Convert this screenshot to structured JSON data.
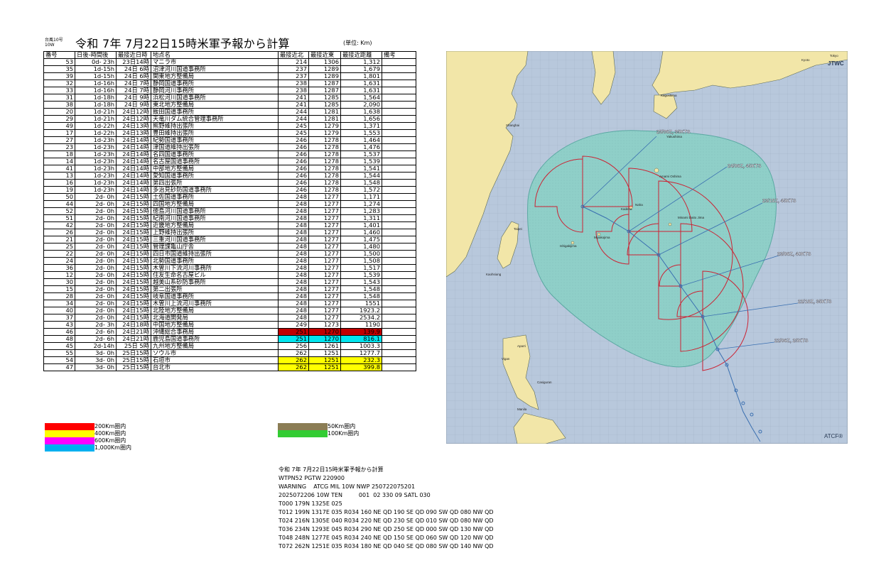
{
  "header": {
    "small_line1": "台風10号",
    "small_line2": "10W",
    "title": "令和 7年 7月22日15時米軍予報から計算",
    "unit": "(単位: Km)"
  },
  "table": {
    "columns": [
      "番号",
      "日後-時間後",
      "最接近日時",
      "地点名",
      "最接近北",
      "最接近東",
      "最接近距離",
      "備考"
    ],
    "rows": [
      [
        "53",
        "0d- 23h",
        "23日14時",
        "マニラ市",
        "214",
        "1306",
        "1,312",
        "",
        ""
      ],
      [
        "35",
        "1d-15h",
        "24日 6時",
        "沼津河川国道事務所",
        "237",
        "1289",
        "1,679",
        "",
        ""
      ],
      [
        "39",
        "1d-15h",
        "24日 6時",
        "関東地方整備局",
        "237",
        "1289",
        "1,801",
        "",
        ""
      ],
      [
        "32",
        "1d-16h",
        "24日 7時",
        "静岡国道事務所",
        "238",
        "1287",
        "1,631",
        "",
        ""
      ],
      [
        "33",
        "1d-16h",
        "24日 7時",
        "静岡河川事務所",
        "238",
        "1287",
        "1,631",
        "",
        ""
      ],
      [
        "31",
        "1d-18h",
        "24日 9時",
        "浜松河川国道事務所",
        "241",
        "1285",
        "1,564",
        "",
        ""
      ],
      [
        "38",
        "1d-18h",
        "24日 9時",
        "東北地方整備局",
        "241",
        "1285",
        "2,090",
        "",
        ""
      ],
      [
        "20",
        "1d-21h",
        "24日12時",
        "飯田国道事務所",
        "244",
        "1281",
        "1,638",
        "",
        ""
      ],
      [
        "29",
        "1d-21h",
        "24日12時",
        "天竜川ダム統合管理事務所",
        "244",
        "1281",
        "1,656",
        "",
        ""
      ],
      [
        "49",
        "1d-22h",
        "24日13時",
        "熊野維持出張所",
        "245",
        "1279",
        "1,371",
        "",
        ""
      ],
      [
        "17",
        "1d-22h",
        "24日13時",
        "豊田維持出張所",
        "245",
        "1279",
        "1,553",
        "",
        ""
      ],
      [
        "27",
        "1d-23h",
        "24日14時",
        "紀勢国道事務所",
        "246",
        "1278",
        "1,464",
        "",
        ""
      ],
      [
        "23",
        "1d-23h",
        "24日14時",
        "津国道維持出張所",
        "246",
        "1278",
        "1,476",
        "",
        ""
      ],
      [
        "18",
        "1d-23h",
        "24日14時",
        "名四国道事務所",
        "246",
        "1278",
        "1,537",
        "",
        ""
      ],
      [
        "14",
        "1d-23h",
        "24日14時",
        "名古屋国道事務所",
        "246",
        "1278",
        "1,539",
        "",
        ""
      ],
      [
        "41",
        "1d-23h",
        "24日14時",
        "中部地方整備局",
        "246",
        "1278",
        "1,541",
        "",
        ""
      ],
      [
        "13",
        "1d-23h",
        "24日14時",
        "愛知国道事務所",
        "246",
        "1278",
        "1,544",
        "",
        ""
      ],
      [
        "16",
        "1d-23h",
        "24日14時",
        "第四出張所",
        "246",
        "1278",
        "1,548",
        "",
        ""
      ],
      [
        "19",
        "1d-23h",
        "24日14時",
        "多治見砂防国道事務所",
        "246",
        "1278",
        "1,572",
        "",
        ""
      ],
      [
        "50",
        "2d- 0h",
        "24日15時",
        "土佐国道事務所",
        "248",
        "1277",
        "1,171",
        "",
        ""
      ],
      [
        "44",
        "2d- 0h",
        "24日15時",
        "四国地方整備局",
        "248",
        "1277",
        "1,274",
        "",
        ""
      ],
      [
        "52",
        "2d- 0h",
        "24日15時",
        "徳島河川国道事務所",
        "248",
        "1277",
        "1,283",
        "",
        ""
      ],
      [
        "51",
        "2d- 0h",
        "24日15時",
        "紀南河川国道事務所",
        "248",
        "1277",
        "1,311",
        "",
        ""
      ],
      [
        "42",
        "2d- 0h",
        "24日15時",
        "近畿地方整備局",
        "248",
        "1277",
        "1,401",
        "",
        ""
      ],
      [
        "26",
        "2d- 0h",
        "24日15時",
        "上野維持出張所",
        "248",
        "1277",
        "1,460",
        "",
        ""
      ],
      [
        "21",
        "2d- 0h",
        "24日15時",
        "三重河川国道事務所",
        "248",
        "1277",
        "1,475",
        "",
        ""
      ],
      [
        "25",
        "2d- 0h",
        "24日15時",
        "管理課亀山庁舎",
        "248",
        "1277",
        "1,480",
        "",
        ""
      ],
      [
        "22",
        "2d- 0h",
        "24日15時",
        "四日市国道維持出張所",
        "248",
        "1277",
        "1,500",
        "",
        ""
      ],
      [
        "24",
        "2d- 0h",
        "24日15時",
        "北勢国道事務所",
        "248",
        "1277",
        "1,508",
        "",
        ""
      ],
      [
        "36",
        "2d- 0h",
        "24日15時",
        "木曽川下流河川事務所",
        "248",
        "1277",
        "1,517",
        "",
        ""
      ],
      [
        "12",
        "2d- 0h",
        "24日15時",
        "住友生命名古屋ビル",
        "248",
        "1277",
        "1,539",
        "",
        ""
      ],
      [
        "30",
        "2d- 0h",
        "24日15時",
        "越美山系砂防事務所",
        "248",
        "1277",
        "1,543",
        "",
        ""
      ],
      [
        "15",
        "2d- 0h",
        "24日15時",
        "第二出張所",
        "248",
        "1277",
        "1,548",
        "",
        ""
      ],
      [
        "28",
        "2d- 0h",
        "24日15時",
        "岐阜国道事務所",
        "248",
        "1277",
        "1,548",
        "",
        ""
      ],
      [
        "34",
        "2d- 0h",
        "24日15時",
        "木曽川上流河川事務所",
        "248",
        "1277",
        "1551",
        "",
        ""
      ],
      [
        "40",
        "2d- 0h",
        "24日15時",
        "北陸地方整備局",
        "248",
        "1277",
        "1923.2",
        "",
        ""
      ],
      [
        "37",
        "2d- 0h",
        "24日15時",
        "北海道開発局",
        "248",
        "1277",
        "2534.2",
        "",
        ""
      ],
      [
        "43",
        "2d- 3h",
        "24日18時",
        "中国地方整備局",
        "249",
        "1273",
        "1190",
        "",
        ""
      ],
      [
        "46",
        "2d- 6h",
        "24日21時",
        "沖縄総合事務局",
        "251",
        "1270",
        "139.9",
        "",
        "red"
      ],
      [
        "48",
        "2d- 6h",
        "24日21時",
        "鹿児島国道事務所",
        "251",
        "1270",
        "816.1",
        "",
        "cyan"
      ],
      [
        "45",
        "2d-14h",
        "25日 5時",
        "九州地方整備局",
        "256",
        "1261",
        "1003.3",
        "",
        ""
      ],
      [
        "55",
        "3d- 0h",
        "25日15時",
        "ソウル市",
        "262",
        "1251",
        "1277.7",
        "",
        ""
      ],
      [
        "54",
        "3d- 0h",
        "25日15時",
        "石垣市",
        "262",
        "1251",
        "232.3",
        "",
        "yellow"
      ],
      [
        "47",
        "3d- 0h",
        "25日15時",
        "台北市",
        "262",
        "1251",
        "399.8",
        "",
        "yellow"
      ]
    ]
  },
  "legend": {
    "items": [
      {
        "label": "200Km圏内",
        "color": "#ff0000"
      },
      {
        "label": "400Km圏内",
        "color": "#ffff00"
      },
      {
        "label": "600Km圏内",
        "color": "#ff00ff"
      },
      {
        "label": "1,000Km圏内",
        "color": "#00b0f0"
      },
      {
        "label": "50Km圏内",
        "color": "#8b7d55"
      },
      {
        "label": "100Km圏内",
        "color": "#33cc33"
      }
    ]
  },
  "forecast": {
    "title": "令和 7年 7月22日15時米軍予報から計算",
    "lines": [
      "WTPN52 PGTW 220900",
      "WARNING    ATCG MIL 10W NWP 250722075201",
      "2025072206 10W TEN         001  02 330 09 SATL 030",
      "T000 179N 1325E 025",
      "T012 199N 1317E 035 R034 160 NE QD 190 SE QD 090 SW QD 080 NW QD",
      "T024 216N 1305E 040 R034 220 NE QD 230 SE QD 010 SW QD 080 NW QD",
      "T036 234N 1293E 045 R034 290 NE QD 250 SE QD 000 SW QD 130 NW QD",
      "T048 248N 1277E 045 R034 240 NE QD 150 SE QD 060 SW QD 120 NW QD",
      "T072 262N 1251E 035 R034 180 NE QD 040 SE QD 080 SW QD 140 NW QD"
    ]
  },
  "map": {
    "agency_top": "JTWC",
    "agency_bottom": "ATCF®",
    "colors": {
      "sea": "#b8c8dc",
      "land": "#f2e6a8",
      "wind_area": "#8fcfc8",
      "track": "#3a6fb0",
      "quadrant": "#cc2233"
    },
    "track_labels": [
      "25/06Z, 35KTS",
      "24/06Z, 45KTS",
      "23/18Z, 45KTS",
      "23/06Z, 40KTS",
      "22/18Z, 35KTS",
      "22/06Z, 25KTS"
    ],
    "places": [
      "Shanghai",
      "Kagoshima",
      "Yakushima",
      "Amami Oshima",
      "Naha",
      "Minami Daito Jima",
      "Kadena",
      "Miyakojima",
      "Taipei",
      "Ishigakijima",
      "Kaohsiung",
      "Aparri",
      "Vigan",
      "Casiguran",
      "Manila",
      "Kyoto",
      "Tokyo"
    ]
  }
}
